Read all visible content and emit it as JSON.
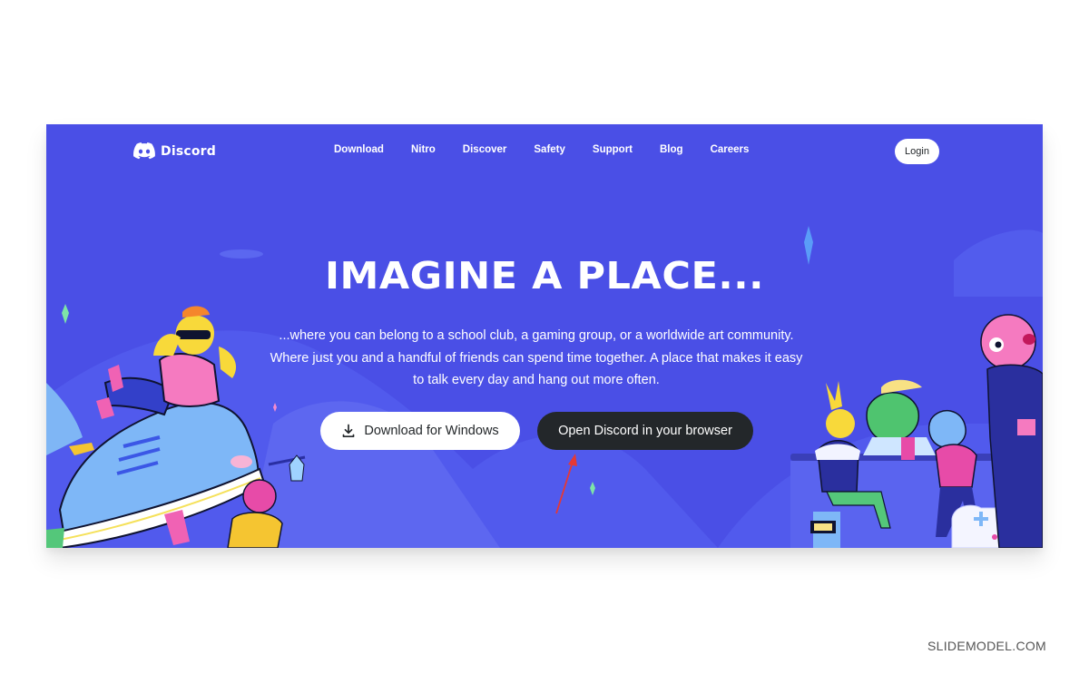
{
  "brand": {
    "name": "Discord",
    "accent_color": "#4a4fe6",
    "dark_button_color": "#23272a"
  },
  "nav": {
    "links": [
      "Download",
      "Nitro",
      "Discover",
      "Safety",
      "Support",
      "Blog",
      "Careers"
    ],
    "login_label": "Login"
  },
  "hero": {
    "headline": "IMAGINE A PLACE...",
    "subtitle": "...where you can belong to a school club, a gaming group, or a worldwide art community. Where just you and a handful of friends can spend time together. A place that makes it easy to talk every day and hang out more often.",
    "download_button": {
      "label": "Download for Windows",
      "icon": "download-icon"
    },
    "browser_button": {
      "label": "Open Discord in your browser"
    }
  },
  "annotation": {
    "arrow_color": "#e53935",
    "target": "browser_button"
  },
  "watermark": "SLIDEMODEL.COM"
}
